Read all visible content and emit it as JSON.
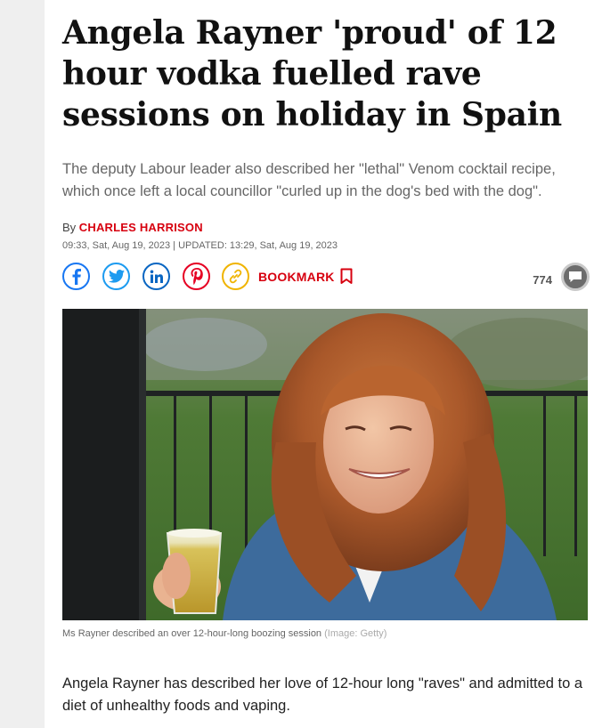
{
  "article": {
    "headline": "Angela Rayner 'proud' of 12 hour vodka fuelled rave sessions on holiday in Spain",
    "standfirst": "The deputy Labour leader also described her \"lethal\" Venom cocktail recipe, which once left a local councillor \"curled up in the dog's bed with the dog\".",
    "byline_prefix": "By",
    "author": "CHARLES HARRISON",
    "dateline": "09:33, Sat, Aug 19, 2023 | UPDATED: 13:29, Sat, Aug 19, 2023",
    "image_caption": "Ms Rayner described an over 12-hour-long boozing session",
    "image_credit": "(Image: Getty)",
    "body_first_paragraph": "Angela Rayner has described her love of 12-hour long \"raves\" and admitted to a diet of unhealthy foods and vaping."
  },
  "share": {
    "buttons": [
      {
        "name": "facebook",
        "icon": "facebook-icon",
        "color": "#1877f2"
      },
      {
        "name": "twitter",
        "icon": "twitter-icon",
        "color": "#1d9bf0"
      },
      {
        "name": "linkedin",
        "icon": "linkedin-icon",
        "color": "#0a66c2"
      },
      {
        "name": "pinterest",
        "icon": "pinterest-icon",
        "color": "#e60023"
      },
      {
        "name": "copy-link",
        "icon": "link-icon",
        "color": "#f0b400"
      }
    ],
    "bookmark_label": "BOOKMARK",
    "comment_count": "774"
  },
  "colors": {
    "brand_red": "#d7000f",
    "headline": "#111111",
    "standfirst": "#666666"
  }
}
